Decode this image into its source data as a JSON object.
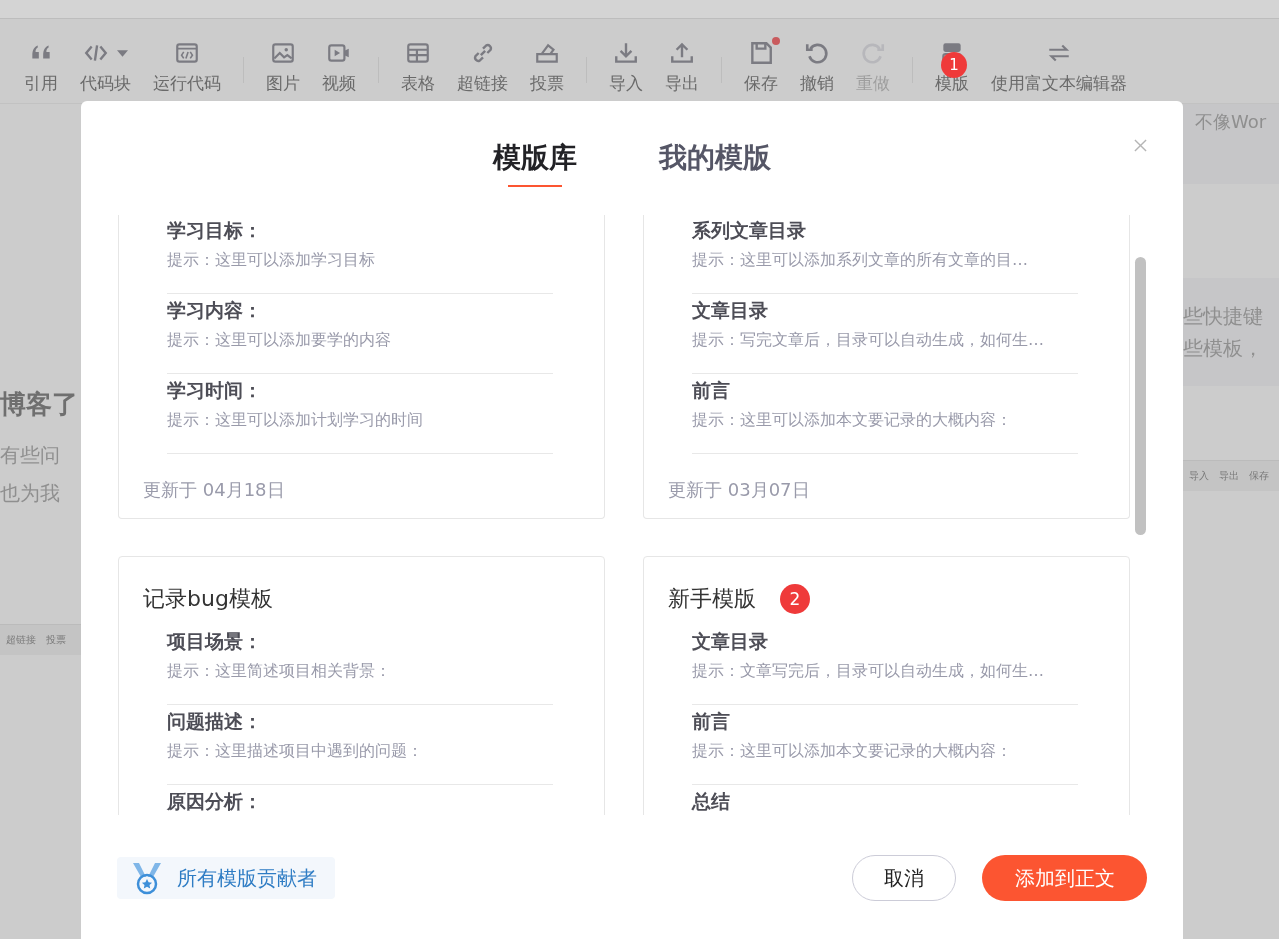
{
  "toolbar": {
    "groups": [
      [
        {
          "label": "引用"
        },
        {
          "label": "代码块",
          "dropdown": true
        },
        {
          "label": "运行代码"
        }
      ],
      [
        {
          "label": "图片"
        },
        {
          "label": "视频"
        }
      ],
      [
        {
          "label": "表格"
        },
        {
          "label": "超链接"
        },
        {
          "label": "投票"
        }
      ],
      [
        {
          "label": "导入"
        },
        {
          "label": "导出"
        }
      ],
      [
        {
          "label": "保存",
          "modified": true
        },
        {
          "label": "撤销"
        },
        {
          "label": "重做",
          "disabled": true
        }
      ],
      [
        {
          "label": "模版",
          "badge": "1"
        },
        {
          "label": "使用富文本编辑器"
        }
      ]
    ]
  },
  "background": {
    "left_texts": [
      {
        "text": "博客了",
        "kind": "heading"
      },
      {
        "text": "有些问",
        "kind": "body"
      },
      {
        "text": "也为我",
        "kind": "body"
      }
    ],
    "left_mini_toolbar": [
      "超链接",
      "投票"
    ],
    "right_texts": [
      {
        "text": "不像Wor",
        "kind": "heading"
      },
      {
        "text": "些快捷键",
        "kind": "body"
      },
      {
        "text": "些模板，",
        "kind": "body"
      }
    ],
    "right_mini_toolbar": [
      "导入",
      "导出",
      "保存"
    ]
  },
  "dialog": {
    "tabs": [
      {
        "label": "模版库",
        "selected": true
      },
      {
        "label": "我的模版",
        "selected": false
      }
    ],
    "cards": [
      {
        "items": [
          {
            "name": "学习目标：",
            "hint": "提示：这里可以添加学习目标"
          },
          {
            "name": "学习内容：",
            "hint": "提示：这里可以添加要学的内容"
          },
          {
            "name": "学习时间：",
            "hint": "提示：这里可以添加计划学习的时间"
          }
        ],
        "updated": "更新于 04月18日"
      },
      {
        "items": [
          {
            "name": "系列文章目录",
            "hint": "提示：这里可以添加系列文章的所有文章的目…"
          },
          {
            "name": "文章目录",
            "hint": "提示：写完文章后，目录可以自动生成，如何生…"
          },
          {
            "name": "前言",
            "hint": "提示：这里可以添加本文要记录的大概内容："
          }
        ],
        "updated": "更新于 03月07日"
      },
      {
        "title": "记录bug模板",
        "items": [
          {
            "name": "项目场景：",
            "hint": "提示：这里简述项目相关背景："
          },
          {
            "name": "问题描述：",
            "hint": "提示：这里描述项目中遇到的问题："
          },
          {
            "name": "原因分析："
          }
        ]
      },
      {
        "title": "新手模版",
        "badge": "2",
        "items": [
          {
            "name": "文章目录",
            "hint": "提示：文章写完后，目录可以自动生成，如何生…"
          },
          {
            "name": "前言",
            "hint": "提示：这里可以添加本文要记录的大概内容："
          },
          {
            "name": "总结"
          }
        ]
      }
    ],
    "contributors": "所有模版贡献者",
    "cancel": "取消",
    "confirm": "添加到正文"
  }
}
